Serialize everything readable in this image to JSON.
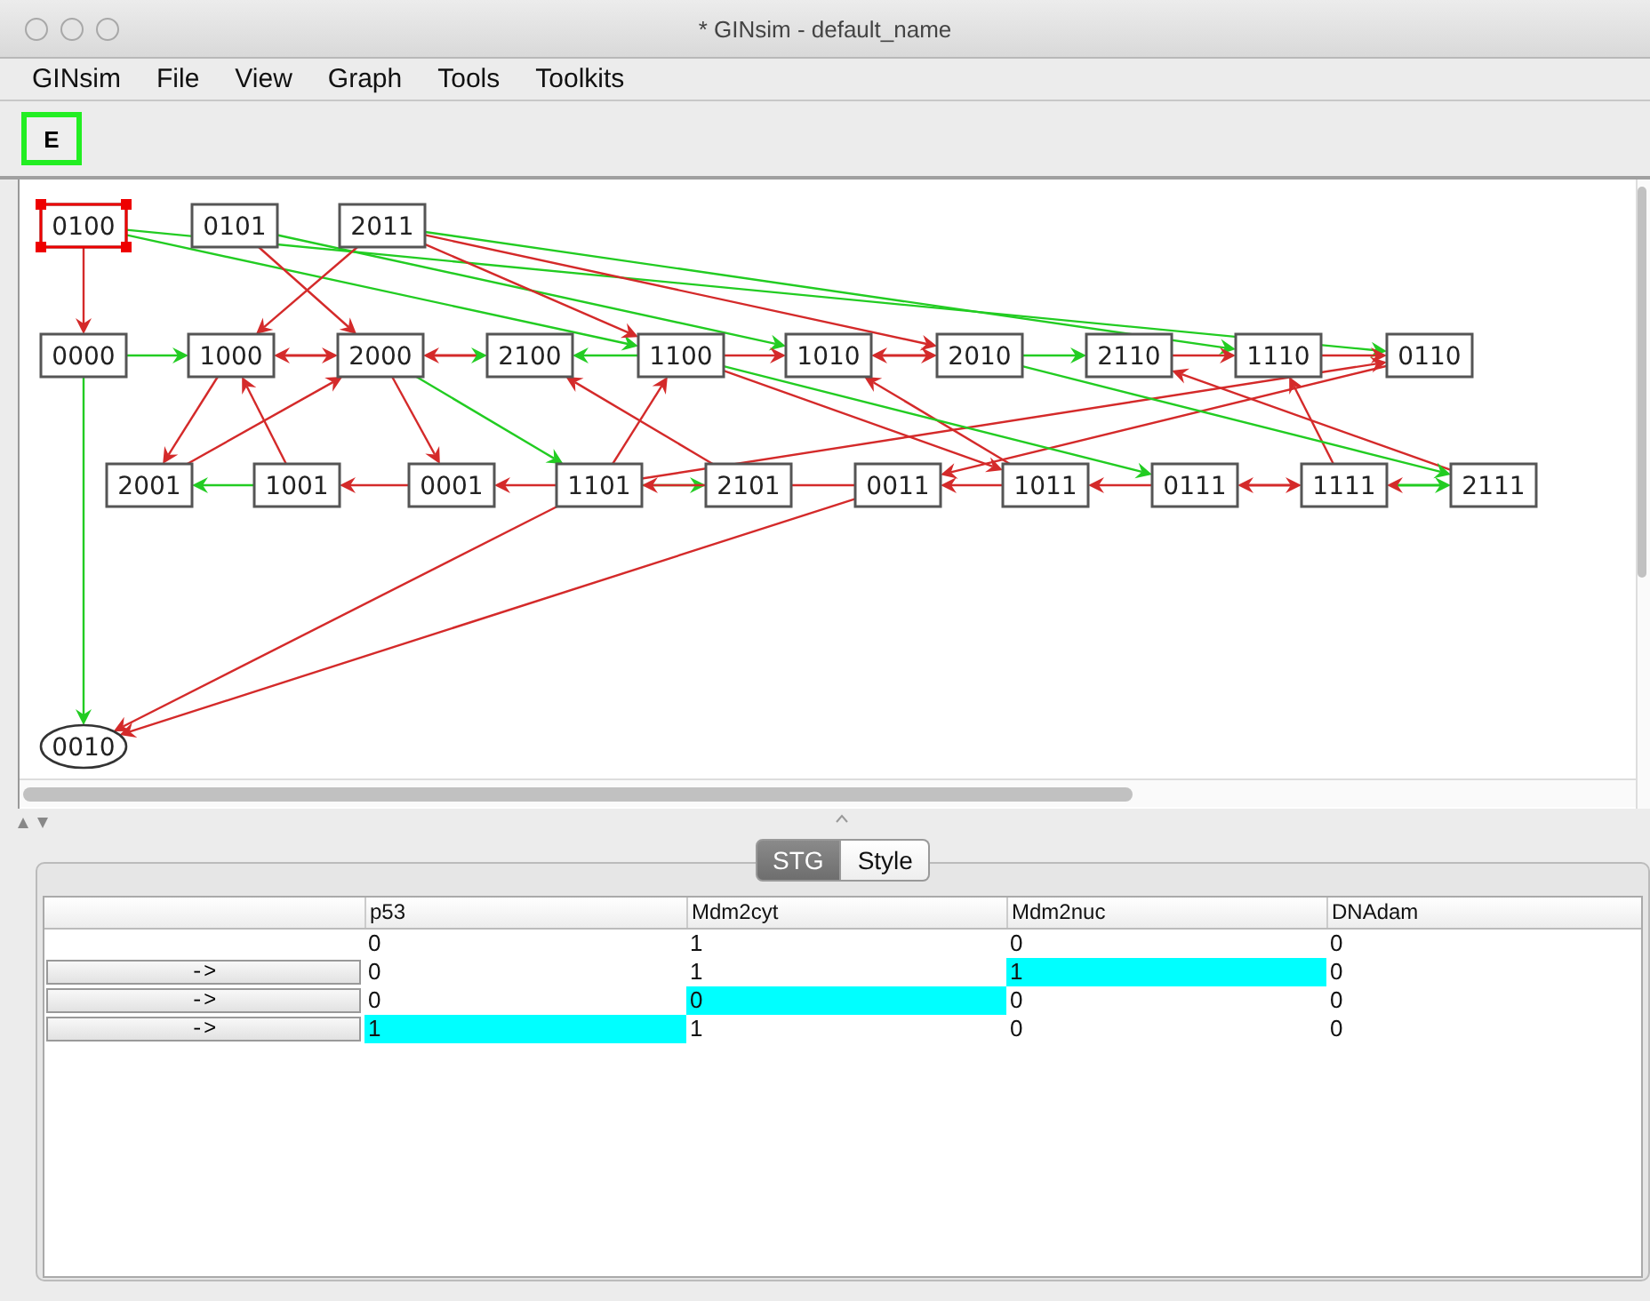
{
  "window": {
    "title": "* GINsim - default_name"
  },
  "menu": [
    "GINsim",
    "File",
    "View",
    "Graph",
    "Tools",
    "Toolkits"
  ],
  "toolbar": [
    {
      "label": "E",
      "selected": true
    }
  ],
  "graph": {
    "nodes": [
      {
        "label": "0100",
        "kind": "box",
        "selected": true
      },
      {
        "label": "0101",
        "kind": "box",
        "selected": false
      },
      {
        "label": "2011",
        "kind": "box",
        "selected": false
      },
      {
        "label": "0000",
        "kind": "box",
        "selected": false
      },
      {
        "label": "1000",
        "kind": "box",
        "selected": false
      },
      {
        "label": "2000",
        "kind": "box",
        "selected": false
      },
      {
        "label": "2100",
        "kind": "box",
        "selected": false
      },
      {
        "label": "1100",
        "kind": "box",
        "selected": false
      },
      {
        "label": "1010",
        "kind": "box",
        "selected": false
      },
      {
        "label": "2010",
        "kind": "box",
        "selected": false
      },
      {
        "label": "2110",
        "kind": "box",
        "selected": false
      },
      {
        "label": "1110",
        "kind": "box",
        "selected": false
      },
      {
        "label": "0110",
        "kind": "box",
        "selected": false
      },
      {
        "label": "2001",
        "kind": "box",
        "selected": false
      },
      {
        "label": "1001",
        "kind": "box",
        "selected": false
      },
      {
        "label": "0001",
        "kind": "box",
        "selected": false
      },
      {
        "label": "1101",
        "kind": "box",
        "selected": false
      },
      {
        "label": "2101",
        "kind": "box",
        "selected": false
      },
      {
        "label": "0011",
        "kind": "box",
        "selected": false
      },
      {
        "label": "1011",
        "kind": "box",
        "selected": false
      },
      {
        "label": "0111",
        "kind": "box",
        "selected": false
      },
      {
        "label": "1111",
        "kind": "box",
        "selected": false
      },
      {
        "label": "2111",
        "kind": "box",
        "selected": false
      },
      {
        "label": "0010",
        "kind": "ellipse",
        "selected": false
      }
    ]
  },
  "tabs": [
    {
      "label": "STG",
      "selected": true
    },
    {
      "label": "Style",
      "selected": false
    }
  ],
  "table": {
    "columns": [
      "p53",
      "Mdm2cyt",
      "Mdm2nuc",
      "DNAdam"
    ],
    "rows": [
      {
        "button": null,
        "cells": [
          {
            "value": "0",
            "changed": false
          },
          {
            "value": "1",
            "changed": false
          },
          {
            "value": "0",
            "changed": false
          },
          {
            "value": "0",
            "changed": false
          }
        ]
      },
      {
        "button": "->",
        "cells": [
          {
            "value": "0",
            "changed": false
          },
          {
            "value": "1",
            "changed": false
          },
          {
            "value": "1",
            "changed": true
          },
          {
            "value": "0",
            "changed": false
          }
        ]
      },
      {
        "button": "->",
        "cells": [
          {
            "value": "0",
            "changed": false
          },
          {
            "value": "0",
            "changed": true
          },
          {
            "value": "0",
            "changed": false
          },
          {
            "value": "0",
            "changed": false
          }
        ]
      },
      {
        "button": "->",
        "cells": [
          {
            "value": "1",
            "changed": true
          },
          {
            "value": "1",
            "changed": false
          },
          {
            "value": "0",
            "changed": false
          },
          {
            "value": "0",
            "changed": false
          }
        ]
      }
    ]
  }
}
